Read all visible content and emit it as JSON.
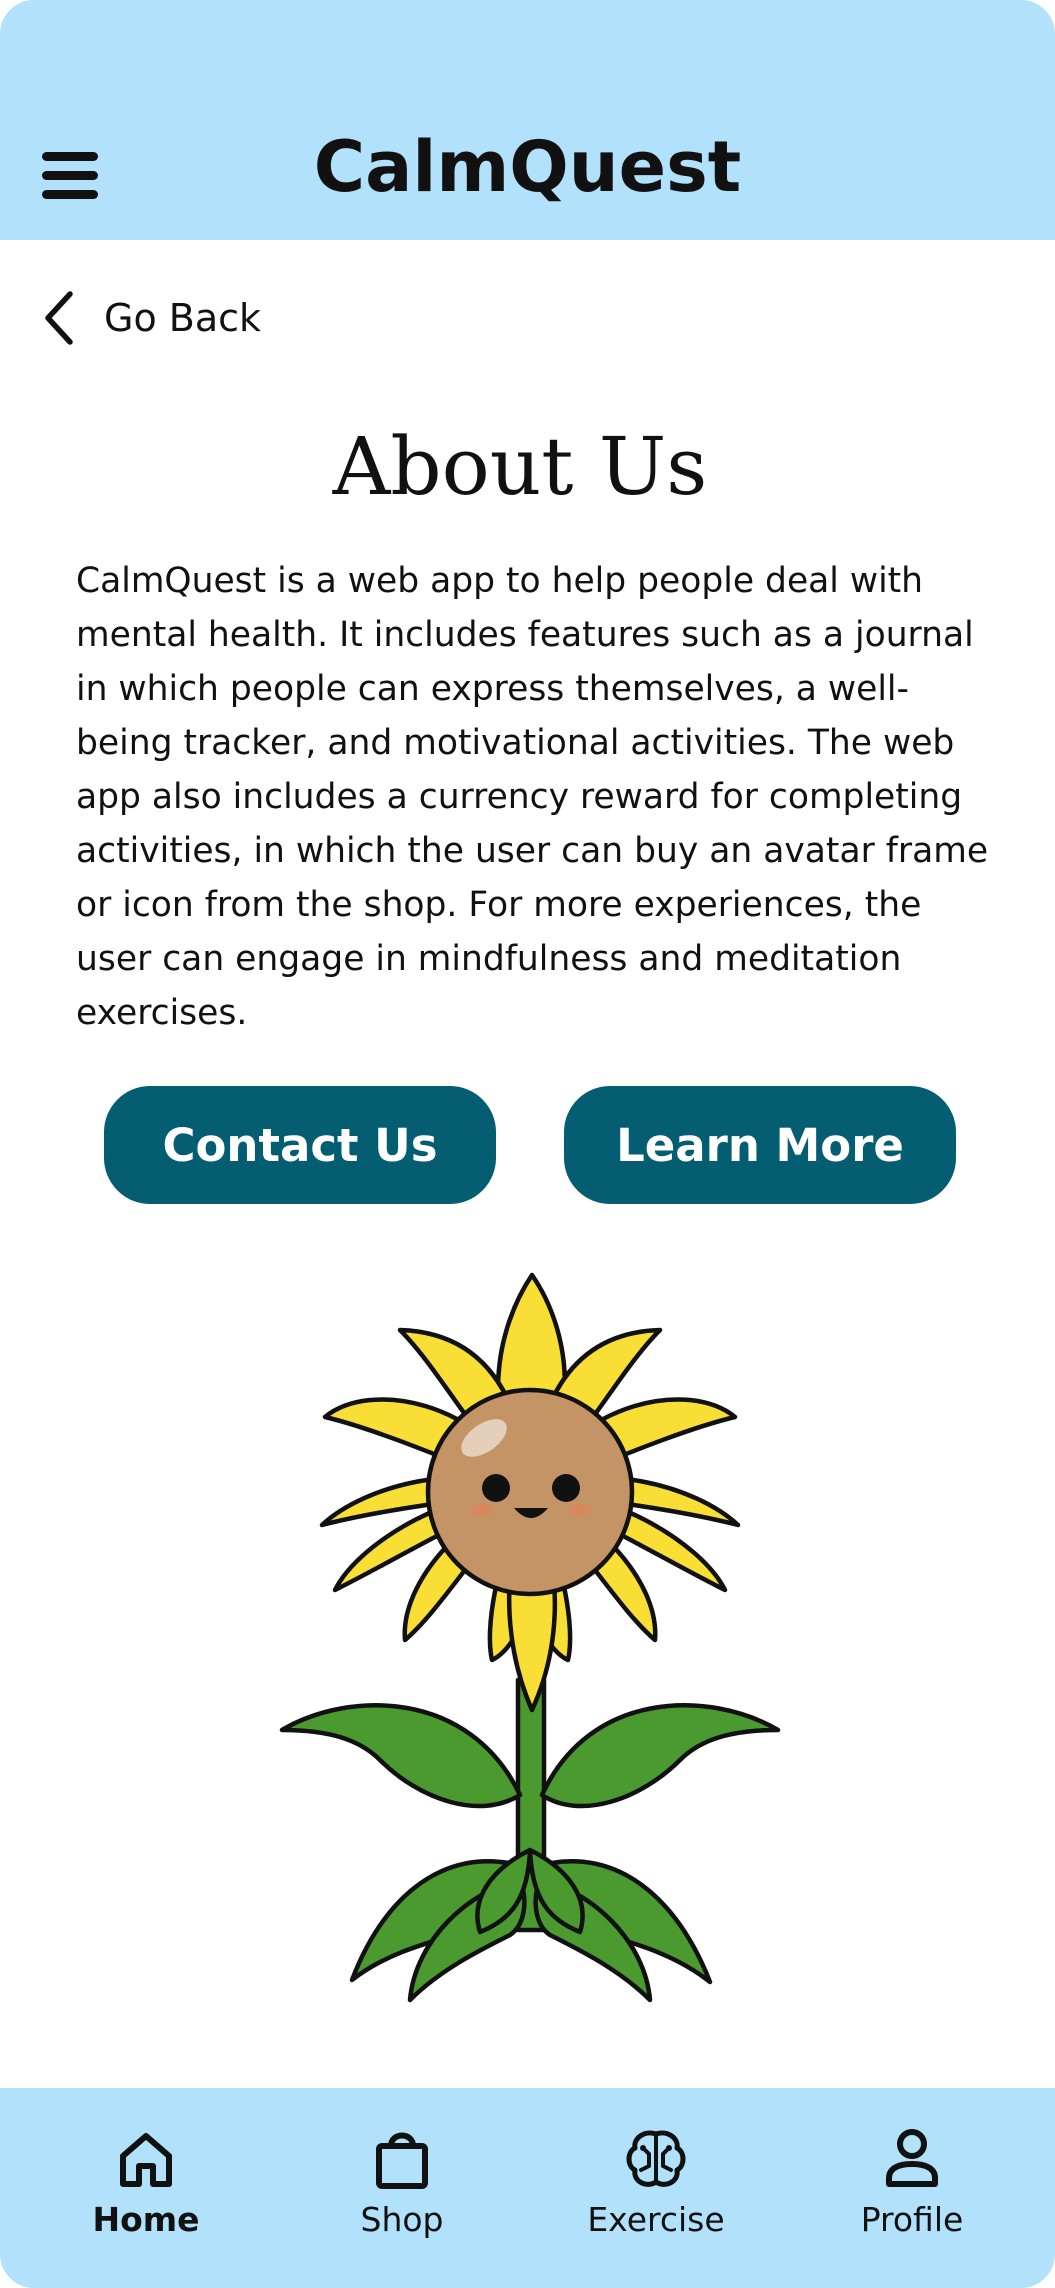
{
  "header": {
    "app_title": "CalmQuest",
    "menu_icon": "hamburger-menu-icon"
  },
  "navigation": {
    "back_label": "Go Back",
    "back_icon": "chevron-left-icon"
  },
  "about": {
    "title": "About Us",
    "body": "CalmQuest is a web app to help people deal with mental health. It includes features such as a journal in which people can express themselves, a well-being tracker, and motivational activities. The web app also includes a currency reward for completing activities, in which the user can buy an avatar frame or icon from the shop. For more experiences, the user can engage in mindfulness and meditation exercises."
  },
  "actions": {
    "contact_label": "Contact Us",
    "learn_label": "Learn More"
  },
  "illustration": {
    "name": "smiling-sunflower"
  },
  "bottom_nav": {
    "items": [
      {
        "label": "Home",
        "icon": "home-icon",
        "active": true
      },
      {
        "label": "Shop",
        "icon": "shopping-bag-icon",
        "active": false
      },
      {
        "label": "Exercise",
        "icon": "brain-icon",
        "active": false
      },
      {
        "label": "Profile",
        "icon": "user-icon",
        "active": false
      }
    ]
  },
  "colors": {
    "header_bg": "#b1e1fb",
    "button_bg": "#055d72",
    "button_text": "#ffffff",
    "petal": "#f9de35",
    "flower_face": "#c49467",
    "leaf": "#4a9a30"
  }
}
